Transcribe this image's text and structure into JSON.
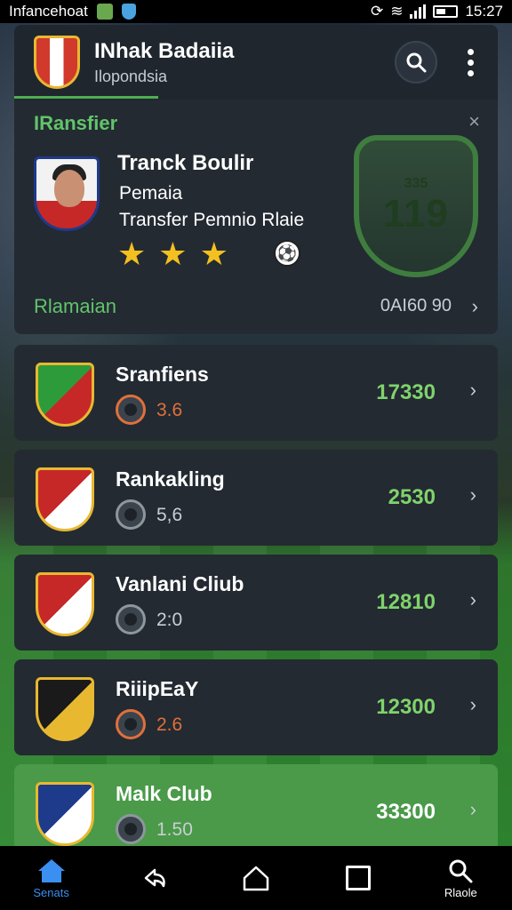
{
  "status_bar": {
    "app_name": "Infancehoat",
    "time": "15:27"
  },
  "header": {
    "title": "INhak Badaiia",
    "subtitle": "Ilopondsia",
    "search_icon": "search-icon",
    "menu_icon": "more-vertical-icon"
  },
  "transfer_card": {
    "title": "IRansfier",
    "close_glyph": "×",
    "player_name": "Tranck Boulir",
    "line1": "Pemaia",
    "line2": "Transfer Pemnio Rlaie",
    "stars": [
      "★",
      "★",
      "★"
    ],
    "badge_small": "335",
    "badge_big": "119",
    "footer_label": "Rlamaian",
    "footer_value": "0AI60 90",
    "chevron": "›"
  },
  "clubs": [
    {
      "name": "Sranfiens",
      "stat": "3.6",
      "value": "17330",
      "stat_color": "#e0703a",
      "crest_colors": [
        "#2e9b3a",
        "#c62828"
      ]
    },
    {
      "name": "Rankakling",
      "stat": "5,6",
      "value": "2530",
      "stat_color": "#c9ced3",
      "crest_colors": [
        "#c62828",
        "#ffffff"
      ]
    },
    {
      "name": "Vanlani Cliub",
      "stat": "2:0",
      "value": "12810",
      "stat_color": "#c9ced3",
      "crest_colors": [
        "#c62828",
        "#ffffff"
      ]
    },
    {
      "name": "RiiipEaY",
      "stat": "2.6",
      "value": "12300",
      "stat_color": "#e0703a",
      "crest_colors": [
        "#1a1a1a",
        "#e8b830"
      ]
    },
    {
      "name": "Malk Club",
      "stat": "1.50",
      "value": "33300",
      "stat_color": "#c9ced3",
      "crest_colors": [
        "#1e3a8a",
        "#ffffff"
      ]
    }
  ],
  "row_chevron": "›",
  "bottom_nav": [
    {
      "name": "home",
      "label": "Senats",
      "glyph": "⌂"
    },
    {
      "name": "back",
      "label": "",
      "glyph": "↶"
    },
    {
      "name": "home-button",
      "label": "",
      "glyph": "⌂"
    },
    {
      "name": "recents",
      "label": "",
      "glyph": ""
    },
    {
      "name": "search",
      "label": "Rlaole",
      "glyph": "⚲"
    }
  ],
  "colors": {
    "accent_green": "#62c46a",
    "card_bg": "#232a32",
    "active_nav": "#3b8ff0"
  }
}
